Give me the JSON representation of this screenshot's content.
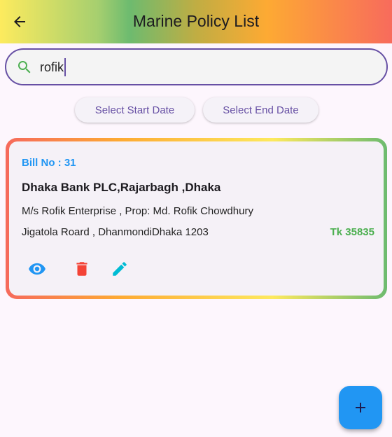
{
  "appbar": {
    "title": "Marine Policy List"
  },
  "search": {
    "value": "rofik"
  },
  "filters": {
    "start_label": "Select Start Date",
    "end_label": "Select End Date"
  },
  "policies": [
    {
      "bill": "Bill No : 31",
      "bank": "Dhaka Bank PLC,Rajarbagh ,Dhaka",
      "client": "M/s Rofik  Enterprise  , Prop: Md. Rofik Chowdhury",
      "address": "Jigatola Roard , DhanmondiDhaka 1203",
      "amount": "Tk 35835"
    }
  ],
  "colors": {
    "accent": "#6750a4",
    "view": "#2196f3",
    "delete": "#f44336",
    "edit": "#00bcd4",
    "amount": "#4caf50"
  }
}
